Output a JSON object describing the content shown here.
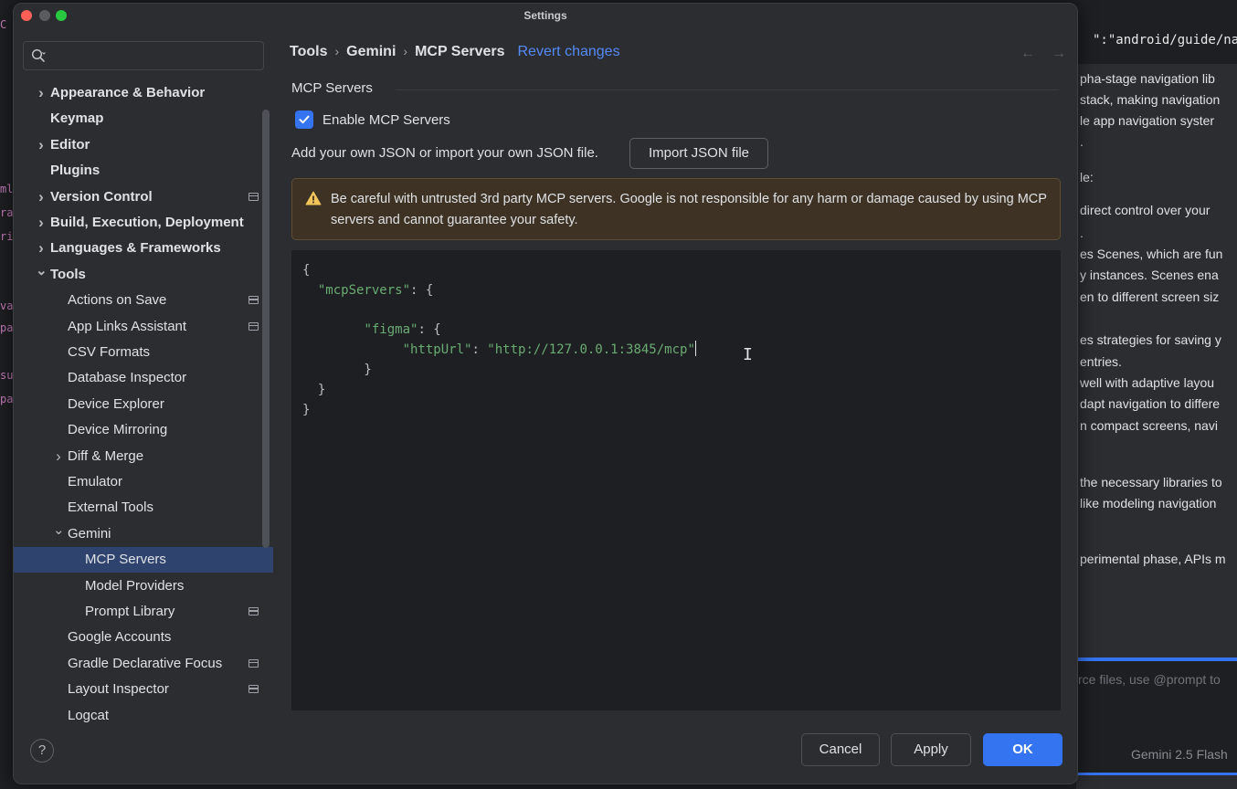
{
  "window": {
    "title": "Settings"
  },
  "search": {
    "placeholder": ""
  },
  "sidebar": {
    "items": [
      {
        "label": "Appearance & Behavior",
        "level": 0,
        "expandable": true,
        "expanded": false,
        "bold": true,
        "project_icon": false,
        "selected": false
      },
      {
        "label": "Keymap",
        "level": 0,
        "expandable": false,
        "expanded": false,
        "bold": true,
        "project_icon": false,
        "selected": false
      },
      {
        "label": "Editor",
        "level": 0,
        "expandable": true,
        "expanded": false,
        "bold": true,
        "project_icon": false,
        "selected": false
      },
      {
        "label": "Plugins",
        "level": 0,
        "expandable": false,
        "expanded": false,
        "bold": true,
        "project_icon": false,
        "selected": false
      },
      {
        "label": "Version Control",
        "level": 0,
        "expandable": true,
        "expanded": false,
        "bold": true,
        "project_icon": true,
        "selected": false
      },
      {
        "label": "Build, Execution, Deployment",
        "level": 0,
        "expandable": true,
        "expanded": false,
        "bold": true,
        "project_icon": false,
        "selected": false
      },
      {
        "label": "Languages & Frameworks",
        "level": 0,
        "expandable": true,
        "expanded": false,
        "bold": true,
        "project_icon": false,
        "selected": false
      },
      {
        "label": "Tools",
        "level": 0,
        "expandable": true,
        "expanded": true,
        "bold": true,
        "project_icon": false,
        "selected": false
      },
      {
        "label": "Actions on Save",
        "level": 1,
        "expandable": false,
        "expanded": false,
        "bold": false,
        "project_icon": true,
        "selected": false
      },
      {
        "label": "App Links Assistant",
        "level": 1,
        "expandable": false,
        "expanded": false,
        "bold": false,
        "project_icon": true,
        "selected": false
      },
      {
        "label": "CSV Formats",
        "level": 1,
        "expandable": false,
        "expanded": false,
        "bold": false,
        "project_icon": false,
        "selected": false
      },
      {
        "label": "Database Inspector",
        "level": 1,
        "expandable": false,
        "expanded": false,
        "bold": false,
        "project_icon": false,
        "selected": false
      },
      {
        "label": "Device Explorer",
        "level": 1,
        "expandable": false,
        "expanded": false,
        "bold": false,
        "project_icon": false,
        "selected": false
      },
      {
        "label": "Device Mirroring",
        "level": 1,
        "expandable": false,
        "expanded": false,
        "bold": false,
        "project_icon": false,
        "selected": false
      },
      {
        "label": "Diff & Merge",
        "level": 1,
        "expandable": true,
        "expanded": false,
        "bold": false,
        "project_icon": false,
        "selected": false
      },
      {
        "label": "Emulator",
        "level": 1,
        "expandable": false,
        "expanded": false,
        "bold": false,
        "project_icon": false,
        "selected": false
      },
      {
        "label": "External Tools",
        "level": 1,
        "expandable": false,
        "expanded": false,
        "bold": false,
        "project_icon": false,
        "selected": false
      },
      {
        "label": "Gemini",
        "level": 1,
        "expandable": true,
        "expanded": true,
        "bold": false,
        "project_icon": false,
        "selected": false
      },
      {
        "label": "MCP Servers",
        "level": 2,
        "expandable": false,
        "expanded": false,
        "bold": false,
        "project_icon": false,
        "selected": true
      },
      {
        "label": "Model Providers",
        "level": 2,
        "expandable": false,
        "expanded": false,
        "bold": false,
        "project_icon": false,
        "selected": false
      },
      {
        "label": "Prompt Library",
        "level": 2,
        "expandable": false,
        "expanded": false,
        "bold": false,
        "project_icon": true,
        "selected": false
      },
      {
        "label": "Google Accounts",
        "level": 1,
        "expandable": false,
        "expanded": false,
        "bold": false,
        "project_icon": false,
        "selected": false
      },
      {
        "label": "Gradle Declarative Focus",
        "level": 1,
        "expandable": false,
        "expanded": false,
        "bold": false,
        "project_icon": true,
        "selected": false
      },
      {
        "label": "Layout Inspector",
        "level": 1,
        "expandable": false,
        "expanded": false,
        "bold": false,
        "project_icon": true,
        "selected": false
      },
      {
        "label": "Logcat",
        "level": 1,
        "expandable": false,
        "expanded": false,
        "bold": false,
        "project_icon": false,
        "selected": false
      }
    ]
  },
  "breadcrumb": {
    "items": [
      "Tools",
      "Gemini",
      "MCP Servers"
    ],
    "separator": "›",
    "revert_label": "Revert changes"
  },
  "content": {
    "section_title": "MCP Servers",
    "enable_label": "Enable MCP Servers",
    "enable_checked": true,
    "add_text": "Add your own JSON or import your own JSON file.",
    "import_button": "Import JSON file",
    "warning_text": "Be careful with untrusted 3rd party MCP servers. Google is not responsible for any harm or damage caused by using MCP servers and cannot guarantee your safety.",
    "json_lines": [
      "{",
      "  \"mcpServers\": {",
      "",
      "        \"figma\": {",
      "             \"httpUrl\": \"http://127.0.0.1:3845/mcp\"",
      "        }",
      "  }",
      "}"
    ]
  },
  "footer": {
    "help_label": "?",
    "cancel_label": "Cancel",
    "apply_label": "Apply",
    "ok_label": "OK"
  },
  "background": {
    "right_url": "\":\"android/guide/nav",
    "right_lines": [
      "pha-stage navigation lib",
      "stack, making navigation",
      "le app navigation syster",
      ".",
      "le:",
      "direct control over your",
      ".",
      "es Scenes, which are fun",
      "y instances. Scenes ena",
      "en to different screen siz",
      "es strategies for saving y",
      "entries.",
      "well with adaptive layou",
      "dapt navigation to differe",
      "n compact screens, navi",
      "the necessary libraries to",
      "like modeling navigation",
      "perimental phase, APIs m"
    ],
    "input_placeholder": "rce files, use @prompt to",
    "model_label": "Gemini 2.5 Flash",
    "left_code": [
      "C",
      "ml",
      "ra",
      "ri",
      "va",
      "pac",
      "su",
      "pac"
    ]
  },
  "colors": {
    "accent": "#3574f0",
    "link": "#548af7",
    "selection": "#2e436e",
    "warning_bg": "#3d3223",
    "json_string": "#6aab73"
  }
}
